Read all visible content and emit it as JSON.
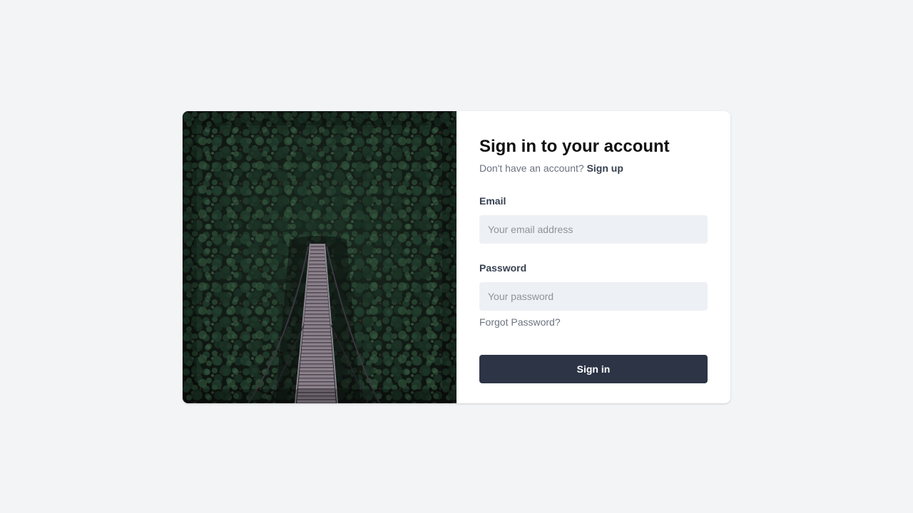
{
  "login": {
    "title": "Sign in to your account",
    "signup_prompt": "Don't have an account?",
    "signup_link": "Sign up",
    "email": {
      "label": "Email",
      "value": "",
      "placeholder": "Your email address"
    },
    "password": {
      "label": "Password",
      "value": "",
      "placeholder": "Your password"
    },
    "forgot_password": "Forgot Password?",
    "submit_label": "Sign in"
  },
  "hero_image": {
    "subject": "suspension-bridge-through-forest"
  },
  "colors": {
    "page_background": "#f3f4f6",
    "card_background": "#ffffff",
    "input_background": "#edf0f4",
    "button_background": "#2d3446",
    "button_text": "#ffffff",
    "heading_text": "#111111",
    "muted_text": "#6b7280",
    "label_text": "#374151"
  }
}
